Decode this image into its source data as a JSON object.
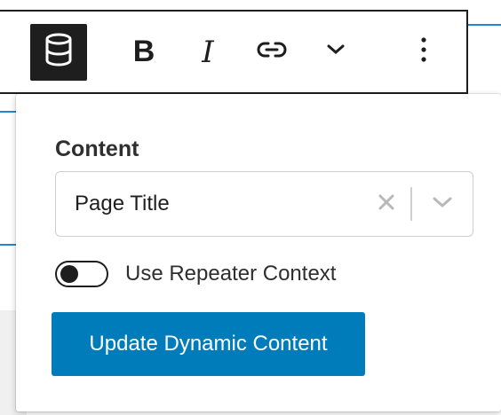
{
  "toolbar": {
    "buttons": [
      {
        "name": "database",
        "icon": "database-icon"
      },
      {
        "name": "bold",
        "label": "B"
      },
      {
        "name": "italic",
        "label": "I"
      },
      {
        "name": "link",
        "icon": "link-icon"
      },
      {
        "name": "more",
        "icon": "chevron-down-icon"
      },
      {
        "name": "options",
        "icon": "vertical-ellipsis-icon"
      }
    ]
  },
  "popover": {
    "content_label": "Content",
    "select": {
      "value": "Page Title",
      "clear_icon": "close-icon",
      "arrow_icon": "chevron-down-icon"
    },
    "toggle": {
      "label": "Use Repeater Context",
      "checked": false
    },
    "update_button_label": "Update Dynamic Content"
  },
  "colors": {
    "accent": "#007cba",
    "toolbar_dark": "#1e1e1e",
    "canvas_line": "#1e88d6"
  }
}
